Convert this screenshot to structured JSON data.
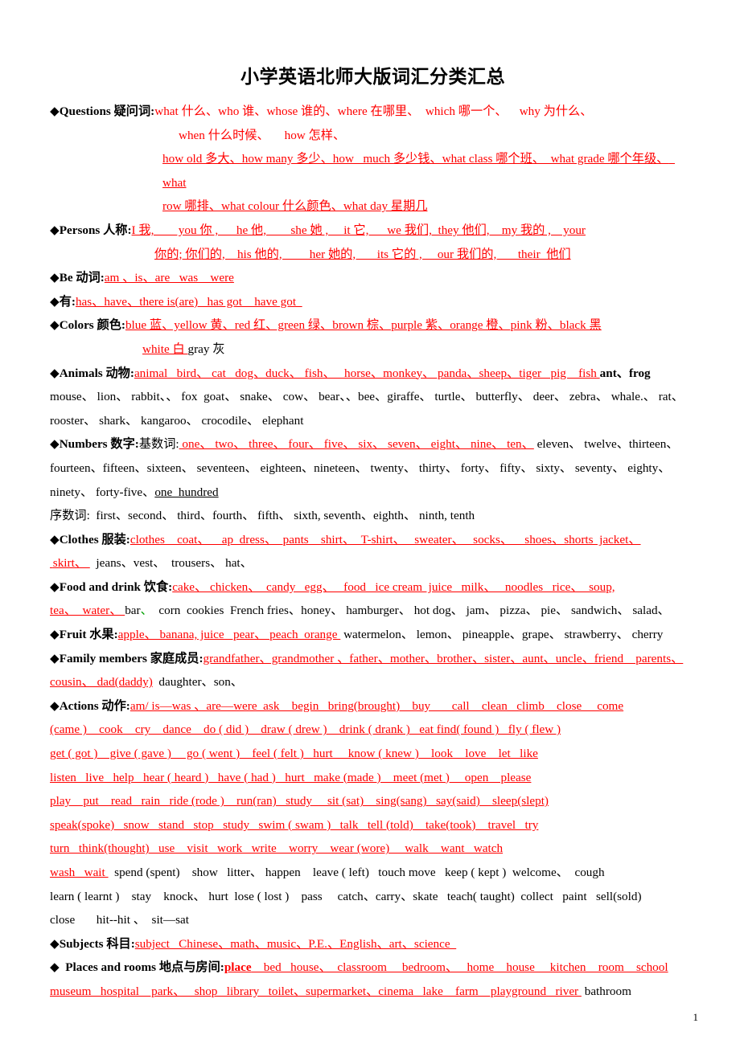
{
  "document": {
    "title": "小学英语北师大版词汇分类汇总",
    "page_number": "1"
  },
  "sections": [
    {
      "bullet": "◆",
      "label": "Questions 疑问词:",
      "lines": [
        "what 什么、who 谁、whose 谁的、where 在哪里、  which 哪一个、    why 为什么、",
        "when 什么时候、     how 怎样、",
        "how old 多大、how many 多少、how   much 多少钱、what class 哪个班、  what grade 哪个年级、  what",
        "row 哪排、what colour 什么颜色、what day 星期几"
      ]
    },
    {
      "bullet": "◆",
      "label": "Persons 人称:",
      "lines": [
        "I 我,        you 你 ,      he 他,        she 她 ,     it 它,      we 我们,  they 他们,    my 我的 ,    your",
        "你的; 你们的,    his 他的,         her 她的,       its 它的 ,     our 我们的,       their  他们"
      ]
    },
    {
      "bullet": "◆",
      "label": "Be 动词:",
      "lines": [
        "am 、is、are   was    were"
      ]
    },
    {
      "bullet": "◆",
      "label": "有:",
      "lines": [
        "has、have、there is(are)   has got    have got  "
      ]
    },
    {
      "bullet": "◆",
      "label": "Colors 颜色:",
      "lines": [
        "blue 蓝、yellow 黄、red 红、green 绿、brown 棕、purple 紫、orange 橙、pink 粉、black 黑",
        "white 白 ",
        "gray 灰"
      ]
    },
    {
      "bullet": "◆",
      "label": "Animals 动物:",
      "red_part": "animal   bird、 cat   dog、duck、 fish、   horse、monkey、 panda、sheep、tiger   pig    fish ",
      "black_part": "ant、frog",
      "black_lines": [
        "mouse、 lion、 rabbit、、 fox  goat、 snake、 cow、 bear、、bee、giraffe、 turtle、 butterfly、 deer、 zebra、 whale.、 rat、",
        "rooster、 shark、 kangaroo、 crocodile、 elephant"
      ]
    },
    {
      "bullet": "◆",
      "label": "Numbers 数字:",
      "sub_label_cardinal": "基数词:",
      "red_part": " one、 two、 three、 four、 five、 six、 seven、 eight、 nine、 ten、",
      "black_part": " eleven、 twelve、thirteen、",
      "black_lines": [
        "fourteen、fifteen、sixteen、 seventeen、 eighteen、nineteen、 twenty、 thirty、 forty、 fifty、 sixty、 seventy、 eighty、",
        "ninety、 forty-five、"
      ],
      "underlined_black": "one  hundred",
      "sub_label_ordinal": "序数词:",
      "ordinal_line": "  first、second、 third、fourth、 fifth、 sixth, seventh、eighth、 ninth, tenth"
    },
    {
      "bullet": "◆",
      "label": "Clothes 服装:",
      "red_lines": [
        "clothes    coat、    ap  dress、  pants    shirt、  T-shirt、   sweater、   socks、    shoes、shorts  jacket、",
        " skirt、 "
      ],
      "black_tail": "  jeans、vest、  trousers、 hat、"
    },
    {
      "bullet": "◆",
      "label": "Food and drink 饮食:",
      "red_line1": "cake、 chicken、  candy   egg、   food   ice cream  juice   milk、   noodles   rice、  soup,",
      "red_line2": "tea、  water、 ",
      "black_tail": "bar",
      "green_comma": "、",
      "black_line2": "  corn  cookies  French fries、honey、 hamburger、 hot dog、 jam、 pizza、 pie、 sandwich、 salad、"
    },
    {
      "bullet": "◆",
      "label": "Fruit 水果:",
      "red_part": "apple、 banana, juice   pear、 peach  orange ",
      "black_part": " watermelon、 lemon、 pineapple、grape、 strawberry、 cherry"
    },
    {
      "bullet": "◆",
      "label": "Family members 家庭成员:",
      "red_lines": [
        "grandfather、grandmother 、father、mother、brother、sister、aunt、uncle、friend    parents、",
        "cousin、 dad(daddy)"
      ],
      "black_tail": "  daughter、son、"
    },
    {
      "bullet": "◆",
      "label": "Actions 动作:",
      "red_lines": [
        "am/ is—was 、are—were  ask    begin   bring(brought)    buy       call    clean   climb    close     come",
        "(came )    cook    cry    dance    do ( did )    draw ( drew )    drink ( drank )   eat find( found )   fly ( flew )",
        "get ( got )    give ( gave )     go ( went )    feel ( felt )   hurt     know ( knew )    look    love    let   like",
        "listen   live   help   hear ( heard )   have ( had )   hurt   make (made )    meet (met )     open    please",
        "play    put    read   rain   ride (rode )    run(ran)   study     sit (sat)    sing(sang)   say(said)    sleep(slept)",
        "speak(spoke)   snow   stand   stop   study   swim ( swam )   talk   tell (told)    take(took)    travel   try",
        "turn   think(thought)   use    visit   work   write    worry    wear (wore)     walk    want   watch",
        "wash   wait "
      ],
      "black_tail": "  spend (spent)    show   litter、 happen    leave ( left)   touch move   keep ( kept )  welcome、  cough",
      "black_lines": [
        "learn ( learnt )    stay    knock、 hurt  lose ( lost )    pass     catch、carry、skate   teach( taught)  collect   paint   sell(sold)",
        "close       hit--hit 、  sit—sat"
      ]
    },
    {
      "bullet": "◆",
      "label": "Subjects 科目:",
      "lines": [
        "subject   Chinese、math、music、P.E.、English、art、science  "
      ]
    },
    {
      "bullet": "◆",
      "label": "Places and rooms 地点与房间:",
      "bold_red": "place",
      "red_lines": [
        "    bed   house、  classroom     bedroom、   home    house     kitchen    room    school",
        "museum   hospital    park、   shop   library   toilet、supermarket、cinema   lake    farm    playground   river "
      ],
      "black_tail": " bathroom"
    }
  ]
}
